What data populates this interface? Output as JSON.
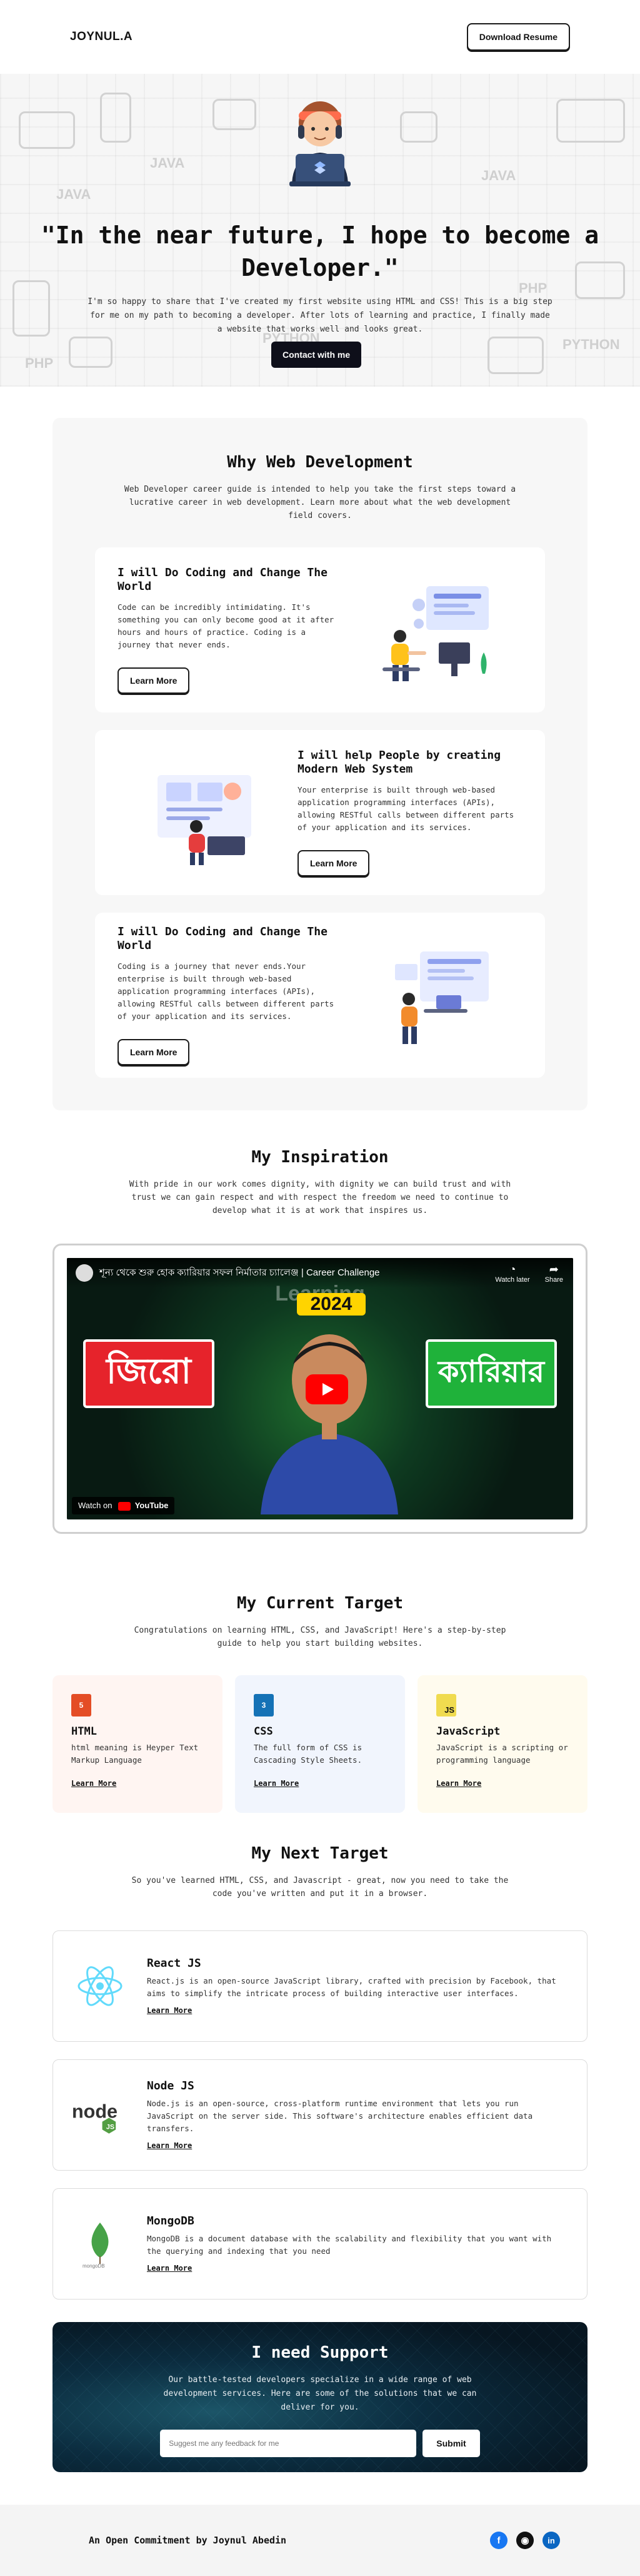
{
  "header": {
    "logo": "JOYNUL.A",
    "download_label": "Download Resume"
  },
  "hero": {
    "title": "\"In the near future, I hope to become a Developer.\"",
    "lead": "I'm so happy to share that I've created my first website using HTML and CSS! This is a big step for me on my path to becoming a developer. After lots of learning and practice, I finally made a website that works well and looks great.",
    "contact_label": "Contact with me",
    "doodle_words": [
      "JAVA",
      "JAVA",
      "PHP",
      "PYTHON",
      "PHP",
      "PYTHON",
      "JAVA"
    ]
  },
  "why": {
    "title": "Why Web Development",
    "subtitle": "Web Developer career guide is intended to help you take the first steps toward a lucrative career in web development. Learn more about what the web development field covers.",
    "cards": [
      {
        "title": "I will Do Coding and Change The World",
        "text": "Code can be incredibly intimidating. It's something you can only become good at it after hours and hours of practice. Coding is a journey that never ends.",
        "button": "Learn More"
      },
      {
        "title": "I will help People by creating Modern Web System",
        "text": "Your enterprise is built through web-based application programming interfaces (APIs), allowing RESTful calls between different parts of your application and its services.",
        "button": "Learn More"
      },
      {
        "title": "I will Do Coding and Change The World",
        "text": "Coding is a journey that never ends.Your enterprise is built through web-based application programming interfaces (APIs), allowing RESTful calls between different parts of your application and its services.",
        "button": "Learn More"
      }
    ]
  },
  "inspiration": {
    "title": "My Inspiration",
    "subtitle": "With pride in our work comes dignity, with dignity we can build trust and with trust we can gain respect and with respect the freedom we need to continue to develop what it is at work that inspires us.",
    "video": {
      "title_text": "শূন্য থেকে শুরু হোক ক্যারিয়ার সফল নির্মাতার চ্যালেঞ্জ | Career Challenge",
      "overlay_word": "Learning",
      "year": "2024",
      "left_badge": "জিরো",
      "right_badge": "ক্যারিয়ার",
      "watch_later": "Watch later",
      "share": "Share",
      "watch_on": "Watch on",
      "youtube": "YouTube"
    }
  },
  "target": {
    "title": "My Current Target",
    "subtitle": "Congratulations on learning HTML, CSS, and JavaScript! Here's a step-by-step guide to help you start building websites.",
    "cards": [
      {
        "icon": "html5-icon",
        "icon_text": "5",
        "title": "HTML",
        "text": "html meaning is Heyper Text Markup Language",
        "link": "Learn More",
        "bg": "#fff5f2",
        "icon_color": "#e44d26"
      },
      {
        "icon": "css3-icon",
        "icon_text": "3",
        "title": "CSS",
        "text": "The full form of CSS is Cascading Style Sheets.",
        "link": "Learn More",
        "bg": "#f1f5fd",
        "icon_color": "#1572b6"
      },
      {
        "icon": "js-icon",
        "icon_text": "JS",
        "title": "JavaScript",
        "text": "JavaScript is a scripting or programming language",
        "link": "Learn More",
        "bg": "#fffbee",
        "icon_color": "#f0db4f"
      }
    ]
  },
  "next": {
    "title": "My Next Target",
    "subtitle": "So you've learned HTML, CSS, and Javascript - great, now you need to take the code you've written and put it in a browser.",
    "cards": [
      {
        "logo": "react-icon",
        "title": "React JS",
        "text": "React.js is an open-source JavaScript library, crafted with precision by Facebook, that aims to simplify the intricate process of building interactive user interfaces.",
        "link": "Learn More"
      },
      {
        "logo": "node-icon",
        "title": "Node JS",
        "text": "Node.js is an open-source, cross-platform runtime environment that lets you run JavaScript on the server side. This software's architecture enables efficient data transfers.",
        "link": "Learn More"
      },
      {
        "logo": "mongodb-icon",
        "title": "MongoDB",
        "text": "MongoDB is a document database with the scalability and flexibility that you want with the querying and indexing that you need",
        "link": "Learn More"
      }
    ]
  },
  "support": {
    "title": "I need Support",
    "text": "Our battle-tested developers specialize in a wide range of web development services. Here are some of the solutions that we can deliver for you.",
    "placeholder": "Suggest me any feedback for me",
    "submit": "Submit"
  },
  "footer": {
    "text": "An Open Commitment by Joynul Abedin",
    "socials": [
      {
        "icon": "facebook-icon",
        "glyph": "f",
        "color": "#1877f2"
      },
      {
        "icon": "github-icon",
        "glyph": "◉",
        "color": "#111111"
      },
      {
        "icon": "linkedin-icon",
        "glyph": "in",
        "color": "#0a66c2"
      }
    ]
  }
}
